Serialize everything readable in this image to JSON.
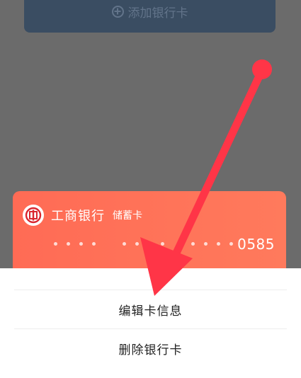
{
  "add_card_button": {
    "label": "添加银行卡",
    "icon": "plus-circle-icon"
  },
  "bank_card": {
    "bank_name": "工商银行",
    "card_type": "储蓄卡",
    "last4": "0585",
    "logo_icon": "icbc-logo-icon",
    "background_color": "#ff6b55"
  },
  "action_sheet": {
    "items": [
      {
        "label": "编辑卡信息"
      },
      {
        "label": "删除银行卡"
      }
    ]
  },
  "annotation": {
    "color": "#ff3547"
  }
}
